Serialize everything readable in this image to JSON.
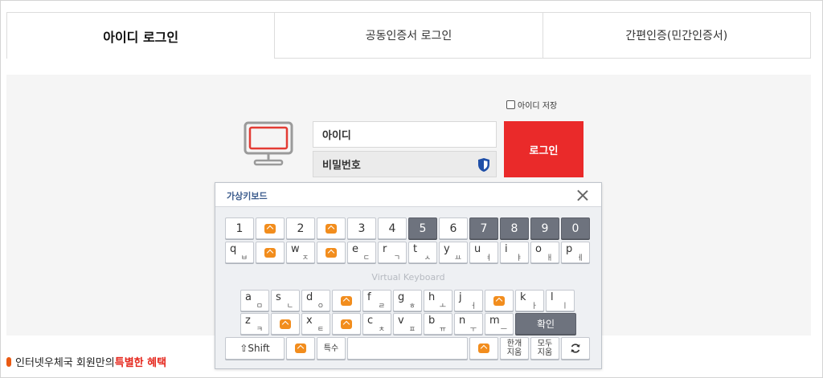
{
  "tabs": [
    {
      "label": "아이디 로그인"
    },
    {
      "label": "공동인증서 로그인"
    },
    {
      "label": "간편인증(민간인증서)"
    }
  ],
  "save_id_label": "아이디 저장",
  "id_placeholder": "아이디",
  "pw_placeholder": "비밀번호",
  "login_label": "로그인",
  "keyboard": {
    "title": "가상키보드",
    "center_label": "Virtual Keyboard",
    "row1": [
      "1",
      "2",
      "3",
      "4",
      "5",
      "6",
      "7",
      "8",
      "9",
      "0"
    ],
    "row2": [
      {
        "en": "q",
        "ko": "ㅂ"
      },
      {
        "en": "w",
        "ko": "ㅈ"
      },
      {
        "en": "e",
        "ko": "ㄷ"
      },
      {
        "en": "r",
        "ko": "ㄱ"
      },
      {
        "en": "t",
        "ko": "ㅅ"
      },
      {
        "en": "y",
        "ko": "ㅛ"
      },
      {
        "en": "u",
        "ko": "ㅕ"
      },
      {
        "en": "i",
        "ko": "ㅑ"
      },
      {
        "en": "o",
        "ko": "ㅐ"
      },
      {
        "en": "p",
        "ko": "ㅔ"
      }
    ],
    "row3": [
      {
        "en": "a",
        "ko": "ㅁ"
      },
      {
        "en": "s",
        "ko": "ㄴ"
      },
      {
        "en": "d",
        "ko": "ㅇ"
      },
      {
        "en": "f",
        "ko": "ㄹ"
      },
      {
        "en": "g",
        "ko": "ㅎ"
      },
      {
        "en": "h",
        "ko": "ㅗ"
      },
      {
        "en": "j",
        "ko": "ㅓ"
      },
      {
        "en": "k",
        "ko": "ㅏ"
      },
      {
        "en": "l",
        "ko": "ㅣ"
      }
    ],
    "row4": [
      {
        "en": "z",
        "ko": "ㅋ"
      },
      {
        "en": "x",
        "ko": "ㅌ"
      },
      {
        "en": "c",
        "ko": "ㅊ"
      },
      {
        "en": "v",
        "ko": "ㅍ"
      },
      {
        "en": "b",
        "ko": "ㅠ"
      },
      {
        "en": "n",
        "ko": "ㅜ"
      },
      {
        "en": "m",
        "ko": "ㅡ"
      }
    ],
    "confirm_label": "확인",
    "shift_label": "⇧Shift",
    "special_label": "특수",
    "korean_delete_label": [
      "한개",
      "지움"
    ],
    "all_delete_label": [
      "모두",
      "지움"
    ],
    "refresh_icon": "refresh-icon"
  },
  "footer": {
    "prefix": "인터넷우체국 회원만의 ",
    "highlight": "특별한 혜택"
  },
  "colors": {
    "login_button": "#ea2a2a",
    "keyboard_dark_key": "#6e737e",
    "badge": "#f28d1d",
    "highlight_text": "#e5261c"
  }
}
